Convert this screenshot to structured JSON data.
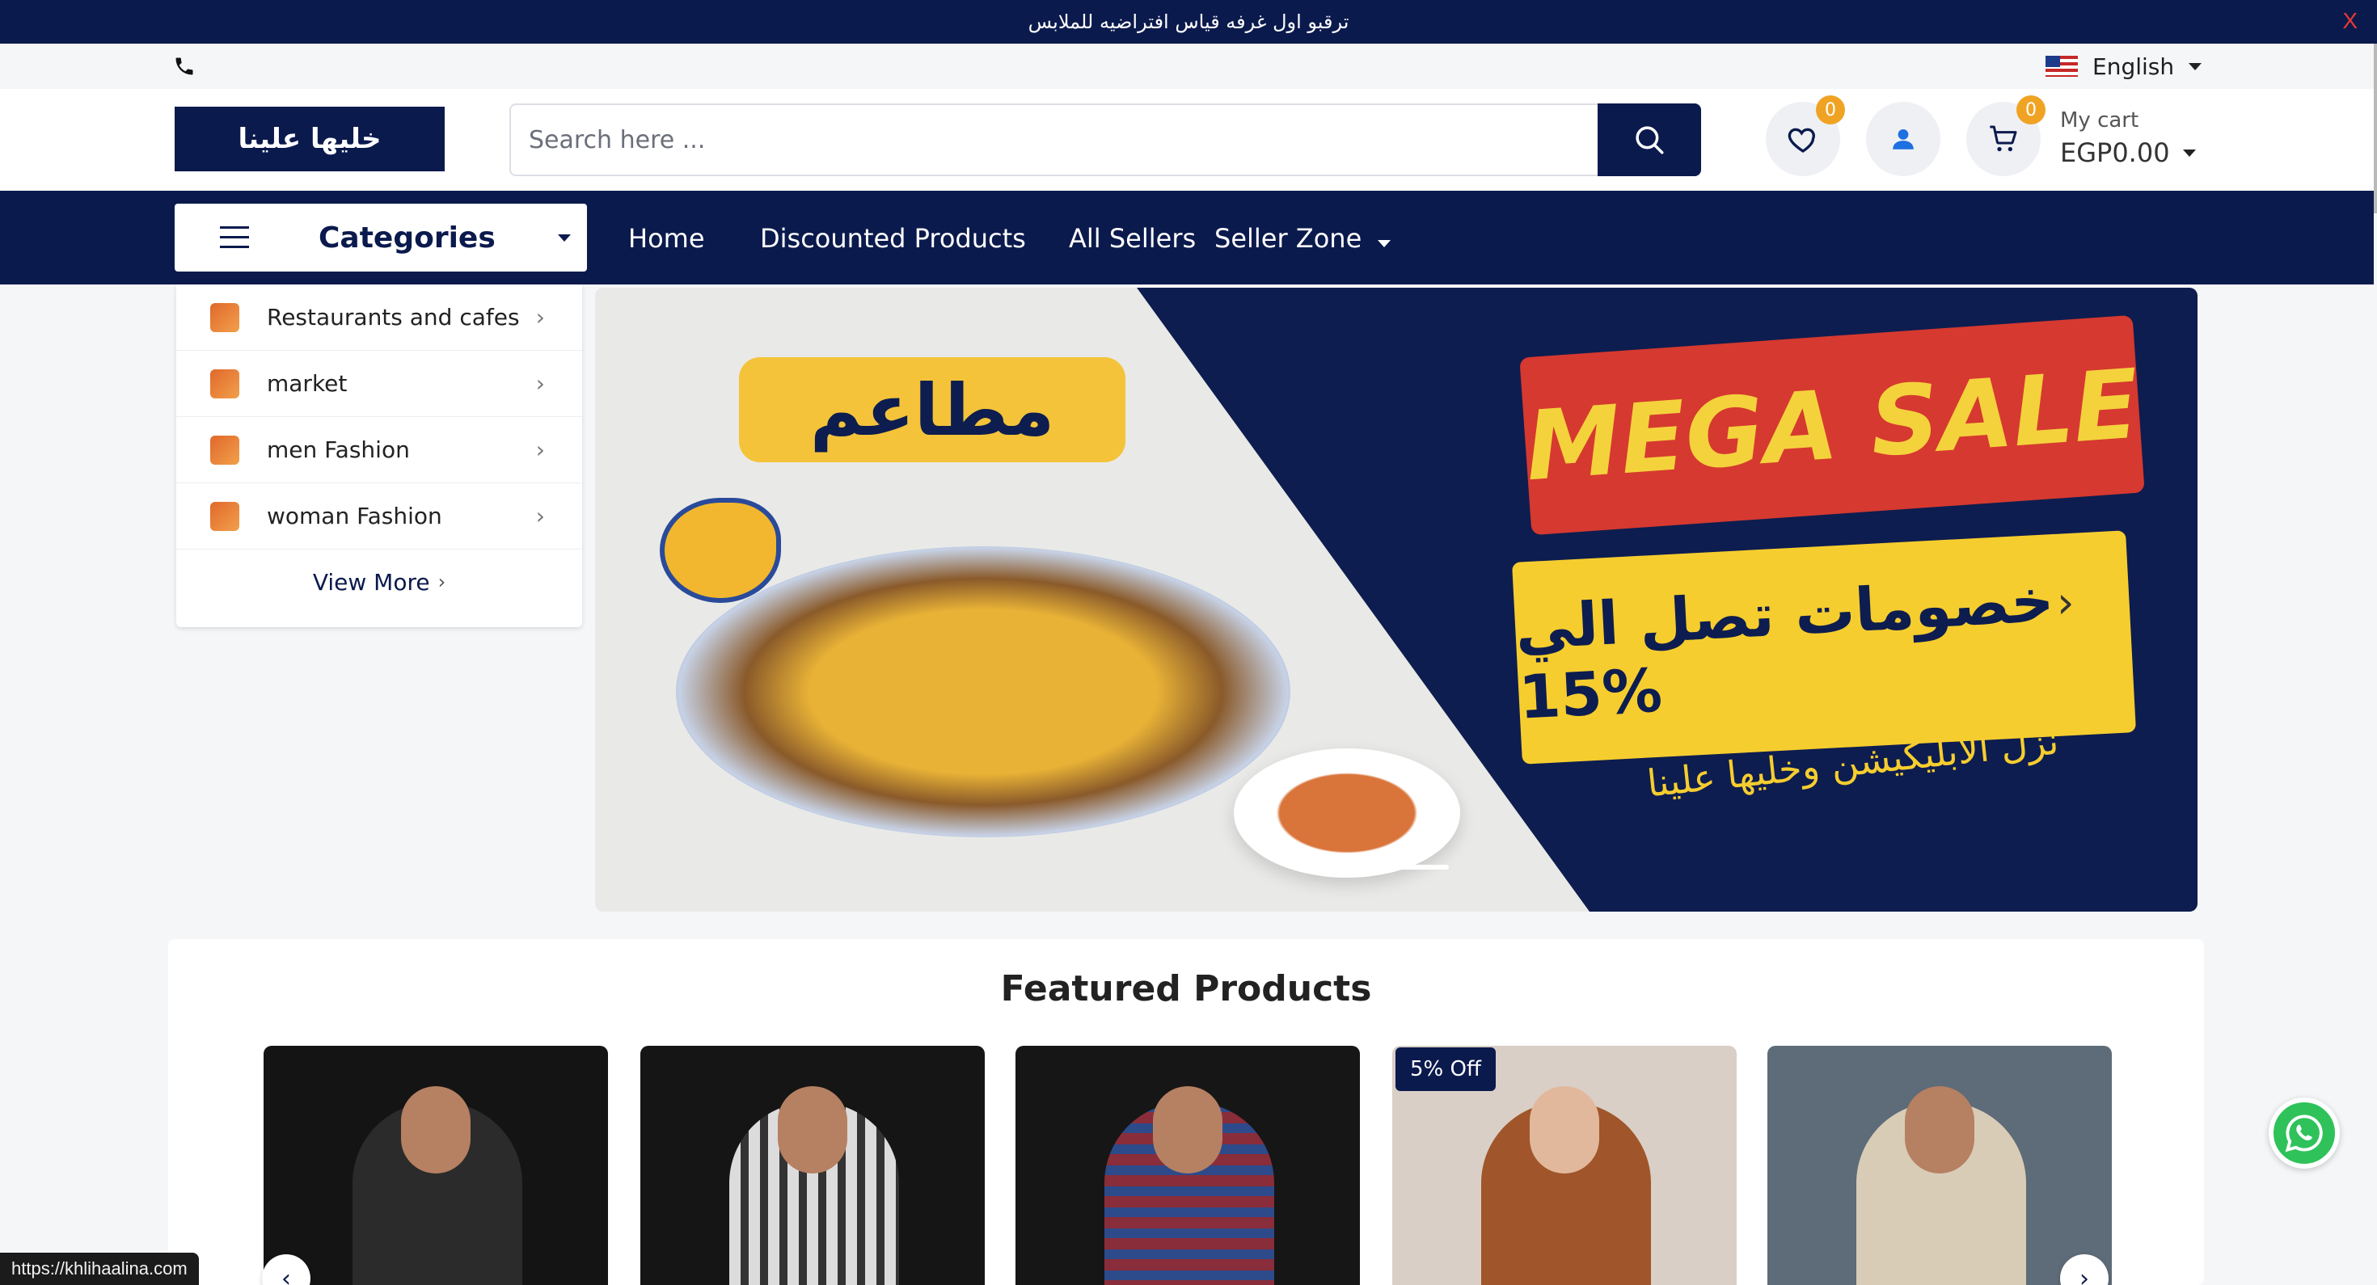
{
  "announcement": {
    "text": "ترقبو اول غرفه قياس افتراضيه للملابس",
    "close": "X"
  },
  "topbar": {
    "language": "English"
  },
  "header": {
    "logo_text": "خليها علينا",
    "search_placeholder": "Search here ...",
    "wishlist_count": "0",
    "cart_count": "0",
    "cart_label": "My cart",
    "cart_total": "EGP0.00"
  },
  "nav": {
    "categories_label": "Categories",
    "items": [
      "Home",
      "Discounted Products",
      "All Sellers",
      "Seller Zone"
    ]
  },
  "category_menu": {
    "items": [
      "Restaurants and cafes",
      "market",
      "men Fashion",
      "woman Fashion"
    ],
    "view_more": "View More"
  },
  "hero": {
    "pill_text": "مطاعم",
    "mega_sale": "MEGA SALE",
    "discount_text": "خصومات تصل الي 15%",
    "subtitle": "نزل الابليكيشن وخليها علينا"
  },
  "featured": {
    "title": "Featured Products",
    "products": [
      {
        "badge": "",
        "tone": "#141414",
        "jacket": "#2b2b2b"
      },
      {
        "badge": "",
        "tone": "#151515",
        "jacket": "#9c9c9c"
      },
      {
        "badge": "",
        "tone": "#161616",
        "jacket": "#8a2d3a"
      },
      {
        "badge": "5% Off",
        "tone": "#d9cfc7",
        "jacket": "#a0562a"
      },
      {
        "badge": "",
        "tone": "#5e6b78",
        "jacket": "#d8ccb7"
      }
    ]
  },
  "status_url": "https://khlihaalina.com",
  "colors": {
    "brand": "#0b1a4d",
    "accent": "#f0a323",
    "whatsapp": "#2fc25a"
  }
}
